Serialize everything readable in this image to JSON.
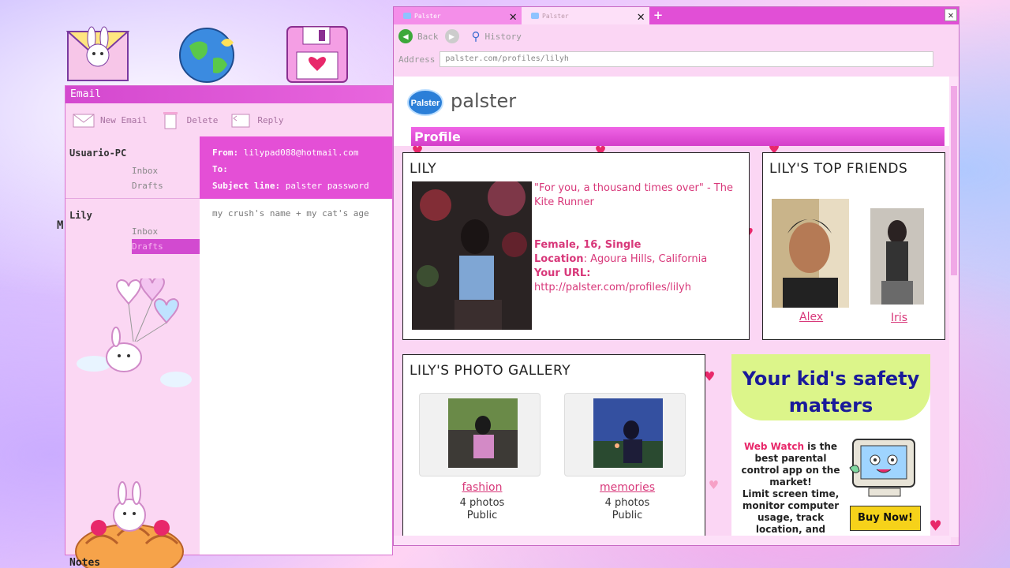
{
  "desktop": {
    "icons": [
      "email-bunny-icon",
      "globe-icon",
      "floppy-disk-icon"
    ],
    "notes_label": "Notes",
    "m_label": "M"
  },
  "email": {
    "window_title": "Email",
    "toolbar": {
      "new_email": "New Email",
      "delete": "Delete",
      "reply": "Reply"
    },
    "accounts": [
      {
        "name": "Usuario-PC",
        "folders": [
          "Inbox",
          "Drafts"
        ]
      },
      {
        "name": "Lily",
        "folders": [
          "Inbox",
          "Drafts"
        ]
      }
    ],
    "message": {
      "from_label": "From:",
      "from_value": "lilypad088@hotmail.com",
      "to_label": "To:",
      "to_value": "",
      "subject_label": "Subject line:",
      "subject_value": "palster password",
      "body": "my crush's name + my cat's age"
    }
  },
  "browser": {
    "tabs": [
      {
        "label": "Palster"
      },
      {
        "label": "Palster"
      }
    ],
    "new_tab": "+",
    "close": "✕",
    "nav": {
      "back": "Back",
      "history": "History"
    },
    "address_label": "Address",
    "address_value": "palster.com/profiles/lilyh"
  },
  "site": {
    "logo_badge": "Palster",
    "logo_text": "palster",
    "section_title": "Profile",
    "profile": {
      "name": "LILY",
      "quote": "\"For you, a thousand times over\" - The Kite Runner",
      "summary": "Female, 16, Single",
      "location_label": "Location",
      "location_value": ": Agoura Hills, California",
      "url_label": "Your URL:",
      "url_value": "http://palster.com/profiles/lilyh"
    },
    "friends": {
      "title": "LILY'S TOP FRIENDS",
      "list": [
        {
          "name": "Alex"
        },
        {
          "name": "Iris"
        }
      ]
    },
    "gallery": {
      "title": "LILY'S PHOTO GALLERY",
      "albums": [
        {
          "name": "fashion",
          "count": "4 photos",
          "visibility": "Public"
        },
        {
          "name": "memories",
          "count": "4 photos",
          "visibility": "Public"
        }
      ]
    },
    "ad": {
      "headline1": "Your kid's safety",
      "headline2": "matters",
      "brand": "Web Watch",
      "text1": " is the best parental control app on the market!",
      "text2": "Limit screen time, monitor computer usage, track location, and more.",
      "cta": "Buy Now!"
    }
  },
  "colors": {
    "accent": "#e44fd6",
    "link": "#d8387a",
    "ad_bg": "#dcf58a",
    "ad_title": "#1a1a9a"
  }
}
